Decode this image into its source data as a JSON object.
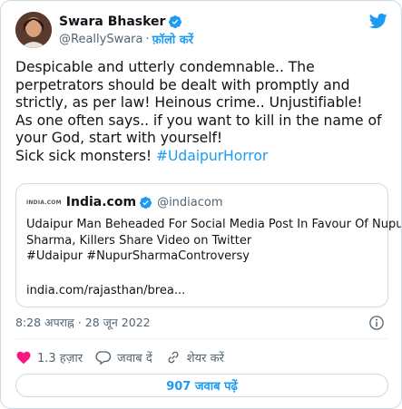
{
  "author": {
    "name": "Swara Bhasker",
    "handle": "@ReallySwara",
    "separator": "·",
    "follow_label": "फ़ॉलो करें"
  },
  "tweet": {
    "lines": [
      "Despicable and utterly condemnable.. The",
      "perpetrators should be dealt with promptly and",
      "strictly, as per law! Heinous crime.. Unjustifiable!",
      "As one often says.. if you want to kill in the name of",
      "your God, start with yourself!"
    ],
    "last_line_prefix": "Sick sick monsters! ",
    "hashtag": "#UdaipurHorror"
  },
  "quote": {
    "logo_text": "INDIA.COM",
    "name": "India.com",
    "handle": "@indiacom",
    "text_lines": [
      "Udaipur Man Beheaded For Social Media Post In Favour Of Nupur",
      "Sharma, Killers Share Video on Twitter",
      "#Udaipur #NupurSharmaControversy"
    ],
    "link": "india.com/rajasthan/brea..."
  },
  "timestamp": "8:28 अपराह्न · 28 जून 2022",
  "actions": {
    "likes": "1.3 हज़ार",
    "reply_label": "जवाब दें",
    "share_label": "शेयर करें"
  },
  "replies_button": "907 जवाब पढ़ें",
  "colors": {
    "accent": "#1d9bf0",
    "like_red": "#f91880",
    "secondary_text": "#536471",
    "border": "#cfd9de"
  }
}
